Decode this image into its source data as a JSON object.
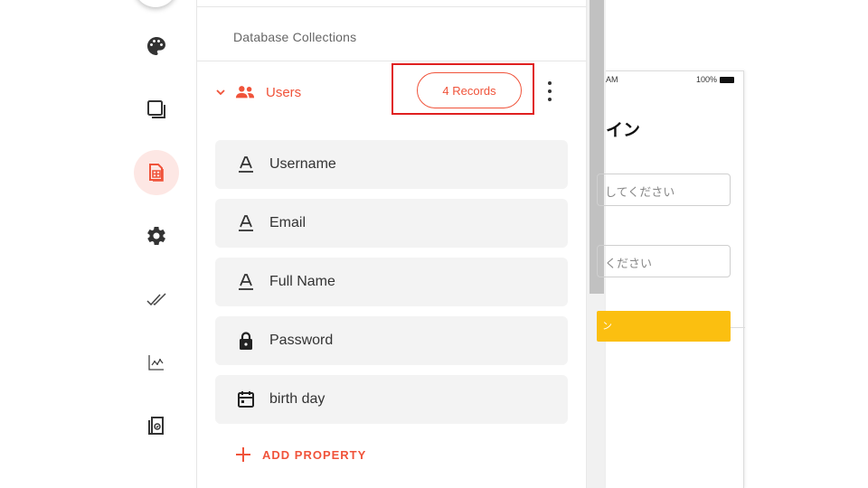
{
  "rail": {
    "items": [
      {
        "name": "palette-icon",
        "active": false
      },
      {
        "name": "screens-icon",
        "active": false
      },
      {
        "name": "database-icon",
        "active": true
      },
      {
        "name": "gear-icon",
        "active": false
      },
      {
        "name": "checks-icon",
        "active": false
      },
      {
        "name": "analytics-icon",
        "active": false
      },
      {
        "name": "publish-icon",
        "active": false
      }
    ]
  },
  "panel": {
    "heading": "Database Collections",
    "collection": {
      "name": "Users",
      "records_label": "4 Records"
    },
    "properties": [
      {
        "label": "Username",
        "icon": "text-icon"
      },
      {
        "label": "Email",
        "icon": "text-icon"
      },
      {
        "label": "Full Name",
        "icon": "text-icon"
      },
      {
        "label": "Password",
        "icon": "lock-icon"
      },
      {
        "label": "birth day",
        "icon": "calendar-icon"
      }
    ],
    "add_property_label": "ADD PROPERTY"
  },
  "phone": {
    "status_time": "AM",
    "status_battery": "100%",
    "title": "イン",
    "input1_text": "してください",
    "input2_text": "ください",
    "button_text": "ン"
  },
  "colors": {
    "accent": "#f0533a",
    "active_bg": "#fde7e4",
    "highlight": "#e02020",
    "phone_button": "#fbbf10"
  }
}
